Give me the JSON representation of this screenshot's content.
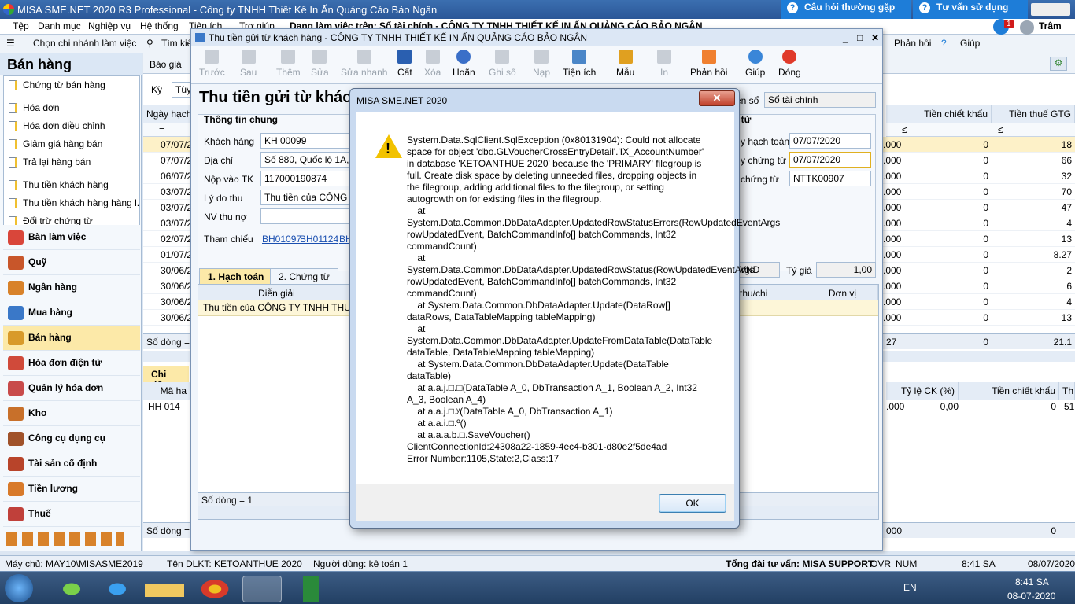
{
  "window": {
    "title": "MISA SME.NET 2020 R3 Professional - Công ty TNHH Thiết Kế In Ấn Quảng Cáo Bảo Ngân"
  },
  "top_buttons": {
    "faq": "Câu hỏi thường gặp",
    "consult": "Tư vấn sử dụng",
    "badge": "1",
    "user": "Trâm"
  },
  "menu": [
    "Tệp",
    "Danh mục",
    "Nghiệp vụ",
    "Hệ thống",
    "Tiện ích",
    "Trợ giúp"
  ],
  "menu_extra": "Dang làm việc trên: Sổ tài chính - CÔNG TY TNHH THIẾT KẾ IN ẤN QUẢNG CÁO BẢO NGÂN",
  "subbar": {
    "branch": "Chọn chi nhánh làm việc",
    "search": "Tìm kiế",
    "feedback": "Phản hồi",
    "help": "Giúp"
  },
  "left": {
    "title": "Bán hàng",
    "doc_items": [
      "Chứng từ bán hàng",
      "Hóa đơn",
      "Hóa đơn điều chỉnh",
      "Giảm giá hàng bán",
      "Trả lại hàng bán",
      "Thu tiền khách hàng",
      "Thu tiền khách hàng hàng l...",
      "Đối trừ chứng từ"
    ],
    "modules": [
      "Bàn làm việc",
      "Quỹ",
      "Ngân hàng",
      "Mua hàng",
      "Bán hàng",
      "Hóa đơn điện tử",
      "Quản lý hóa đơn",
      "Kho",
      "Công cụ dụng cụ",
      "Tài sản cố định",
      "Tiền lương",
      "Thuế"
    ]
  },
  "bg": {
    "report_tab": "Báo giá",
    "period_label": "Kỳ",
    "period_value": "Tùy",
    "col_date": "Ngày hạch",
    "col_discount": "Tiền chiết khấu",
    "col_vat": "Tiền thuế GTG",
    "dates": [
      "07/07/2",
      "07/07/2",
      "06/07/2",
      "03/07/2",
      "03/07/2",
      "03/07/2",
      "02/07/2",
      "01/07/2",
      "30/06/2",
      "30/06/2",
      "30/06/2",
      "30/06/2"
    ],
    "amount_frag": [
      ".000",
      ".000",
      ".000",
      ".000",
      ".000",
      ".000",
      ".000",
      ".000",
      ".000",
      ".000",
      ".000",
      ".000"
    ],
    "discounts": [
      "0",
      "0",
      "0",
      "0",
      "0",
      "0",
      "0",
      "0",
      "0",
      "0",
      "0",
      "0"
    ],
    "vat": [
      "18",
      "66",
      "32",
      "70",
      "47",
      "4",
      "13",
      "8.27",
      "2",
      "6",
      "4",
      "13"
    ],
    "total_label": "Số dòng = 5",
    "total_amount": "27",
    "total_discount": "0",
    "total_vat": "21.1",
    "detail_tab": "Chi tiết",
    "detail_col_code": "Mã ha",
    "detail_col_ck": "Tỷ lệ CK (%)",
    "detail_col_tck": "Tiền chiết khấu",
    "detail_col_th": "Th",
    "detail_row": {
      "code": "HH 014",
      "amount": ".000",
      "ck": "0,00",
      "tck": "0",
      "th": "51"
    },
    "bottom_count": "Số dòng = 1",
    "bottom_amount": "000",
    "bottom_zero": "0"
  },
  "child": {
    "title": "Thu tiền gửi từ khách hàng - CÔNG TY TNHH THIẾT KẾ IN ẤN QUẢNG CÁO BẢO NGÂN",
    "tools": [
      "Trước",
      "Sau",
      "Thêm",
      "Sửa",
      "Sửa nhanh",
      "Cất",
      "Xóa",
      "Hoãn",
      "Ghi sổ",
      "Nạp",
      "Tiện ích",
      "Mẫu",
      "In",
      "Phản hồi",
      "Giúp",
      "Đóng"
    ],
    "heading": "Thu tiền gửi từ khác",
    "book_label": "ện sổ",
    "book_value": "Sổ tài chính",
    "section_general": "Thông tin chung",
    "section_voucher": "g từ",
    "customer_label": "Khách hàng",
    "customer_value": "KH 00099",
    "address_label": "Địa chỉ",
    "address_value": "Số 880, Quốc lộ 1A, K",
    "account_label": "Nộp vào TK",
    "account_value": "117000190874",
    "reason_label": "Lý do thu",
    "reason_value": "Thu tiền của CÔNG T",
    "staff_label": "NV thu nợ",
    "ref_label": "Tham chiếu",
    "refs": [
      "BH01097",
      "BH01124",
      "BH"
    ],
    "post_date_label": "y hạch toán",
    "post_date": "07/07/2020",
    "doc_date_label": "y chứng từ",
    "doc_date": "07/07/2020",
    "doc_no_label": "chứng từ",
    "doc_no": "NTTK00907",
    "currency": "VND",
    "rate_label": "Tỷ giá",
    "rate": "1,00",
    "tab1": "1. Hạch toán",
    "tab2": "2. Chứng từ",
    "col_desc": "Diễn giải",
    "col_obj": "thu/chi",
    "col_unit": "Đơn vị",
    "row_desc": "Thu tiền của CÔNG TY TNHH THƯƠ",
    "row_count": "Số dòng = 1"
  },
  "dialog": {
    "title": "MISA SME.NET 2020",
    "close": "✕",
    "message": "System.Data.SqlClient.SqlException (0x80131904): Could not allocate space for object 'dbo.GLVoucherCrossEntryDetail'.'IX_AccountNumber' in database 'KETOANTHUE 2020' because the 'PRIMARY' filegroup is full. Create disk space by deleting unneeded files, dropping objects in the filegroup, adding additional files to the filegroup, or setting autogrowth on for existing files in the filegroup.\n    at System.Data.Common.DbDataAdapter.UpdatedRowStatusErrors(RowUpdatedEventArgs rowUpdatedEvent, BatchCommandInfo[] batchCommands, Int32 commandCount)\n    at System.Data.Common.DbDataAdapter.UpdatedRowStatus(RowUpdatedEventArgs rowUpdatedEvent, BatchCommandInfo[] batchCommands, Int32 commandCount)\n    at System.Data.Common.DbDataAdapter.Update(DataRow[] dataRows, DataTableMapping tableMapping)\n    at System.Data.Common.DbDataAdapter.UpdateFromDataTable(DataTable dataTable, DataTableMapping tableMapping)\n    at System.Data.Common.DbDataAdapter.Update(DataTable dataTable)\n    at a.a.j.□.□(DataTable A_0, DbTransaction A_1, Boolean A_2, Int32 A_3, Boolean A_4)\n    at a.a.j.□.ʸ(DataTable A_0, DbTransaction A_1)\n    at a.a.i.□.º()\n    at a.a.a.b.□.SaveVoucher()\nClientConnectionId:24308a22-1859-4ec4-b301-d80e2f5de4ad\nError Number:1105,State:2,Class:17",
    "ok": "OK"
  },
  "status": {
    "server": "Máy chủ: MAY10\\MISASME2019",
    "db": "Tên DLKT: KETOANTHUE 2020",
    "user": "Người dùng: kê toán 1",
    "hotline": "Tổng đài tư vấn: MISA SUPPORT",
    "ovr": "OVR",
    "num": "NUM",
    "time": "8:41 SA",
    "date": "08/07/2020"
  },
  "taskbar": {
    "lang": "EN",
    "time": "8:41 SA",
    "date": "08-07-2020"
  },
  "colors": {
    "accent": "#1e7dd8",
    "active_module": "#fce9a8",
    "warning": "#f2c200"
  }
}
